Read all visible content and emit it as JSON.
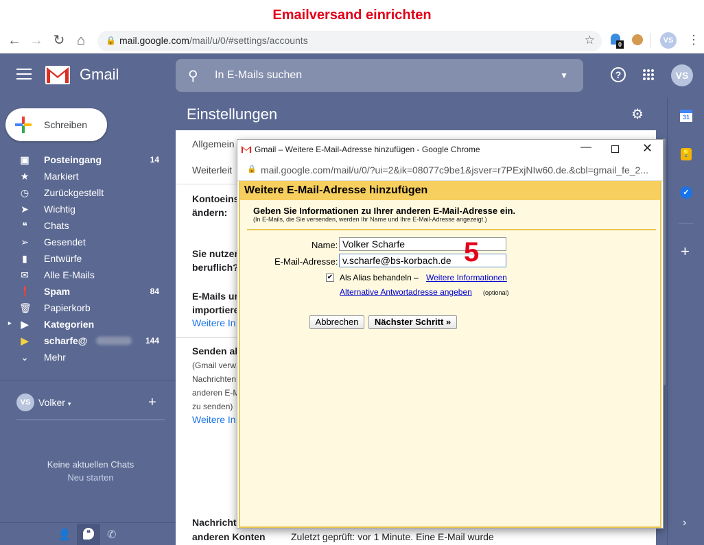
{
  "caption": "Emailversand einrichten",
  "browser": {
    "url_host": "mail.google.com",
    "url_path": "/mail/u/0/#settings/accounts",
    "ext_badge": "0",
    "profile": "VS"
  },
  "gmail": {
    "logo_text": "Gmail",
    "search_placeholder": "In E-Mails suchen",
    "avatar": "VS"
  },
  "compose_label": "Schreiben",
  "nav": [
    {
      "label": "Posteingang",
      "count": "14",
      "icon": "inbox-icon",
      "bold": true
    },
    {
      "label": "Markiert",
      "count": "",
      "icon": "star-icon",
      "bold": false
    },
    {
      "label": "Zurückgestellt",
      "count": "",
      "icon": "clock-icon",
      "bold": false
    },
    {
      "label": "Wichtig",
      "count": "",
      "icon": "important-icon",
      "bold": false
    },
    {
      "label": "Chats",
      "count": "",
      "icon": "chat-icon",
      "bold": false
    },
    {
      "label": "Gesendet",
      "count": "",
      "icon": "send-icon",
      "bold": false
    },
    {
      "label": "Entwürfe",
      "count": "",
      "icon": "draft-icon",
      "bold": false
    },
    {
      "label": "Alle E-Mails",
      "count": "",
      "icon": "mail-icon",
      "bold": false
    },
    {
      "label": "Spam",
      "count": "84",
      "icon": "spam-icon",
      "bold": true
    },
    {
      "label": "Papierkorb",
      "count": "",
      "icon": "trash-icon",
      "bold": false
    },
    {
      "label": "Kategorien",
      "count": "",
      "icon": "label-icon",
      "bold": true
    },
    {
      "label": "scharfe@",
      "count": "144",
      "icon": "label-yellow-icon",
      "bold": true
    },
    {
      "label": "Mehr",
      "count": "",
      "icon": "chevron-down-icon",
      "bold": false
    }
  ],
  "hangouts": {
    "user": "Volker",
    "avatar": "VS",
    "no_chats": "Keine aktuellen Chats",
    "start": "Neu starten"
  },
  "settings": {
    "title": "Einstellungen",
    "tab1": "Allgemein",
    "tab2": "Weiterleit",
    "s1a": "Kontoeins",
    "s1b": "ändern:",
    "s2a": "Sie nutzer",
    "s2b": "beruflich?",
    "s3a": "E-Mails ur",
    "s3b": "importiere",
    "s3link": "Weitere In",
    "s4a": "Senden als",
    "s4b": "(Gmail verw",
    "s4c": "Nachrichten",
    "s4d": "anderen E-M",
    "s4e": "zu senden)",
    "s4link": "Weitere In",
    "s5a": "Nachricht",
    "s5b": "anderen Konten",
    "s5val": "Zuletzt geprüft: vor 1 Minute. Eine E-Mail wurde"
  },
  "popup": {
    "window_title": "Gmail – Weitere E-Mail-Adresse hinzufügen - Google Chrome",
    "url": "mail.google.com/mail/u/0/?ui=2&ik=08077c9be1&jsver=r7PExjNIw60.de.&cbl=gmail_fe_2...",
    "heading": "Weitere E-Mail-Adresse hinzufügen",
    "intro": "Geben Sie Informationen zu Ihrer anderen E-Mail-Adresse ein.",
    "intro_small": "(In E-Mails, die Sie versenden, werden Ihr Name und Ihre E-Mail-Adresse angezeigt.)",
    "name_label": "Name:",
    "name_value": "Volker Scharfe",
    "email_label": "E-Mail-Adresse:",
    "email_value": "v.scharfe@bs-korbach.de",
    "step_marker": "5",
    "alias_label": "Als Alias behandeln –",
    "alias_link": "Weitere Informationen",
    "alias_checked": true,
    "reply_link": "Alternative Antwortadresse angeben",
    "optional": "(optional)",
    "cancel": "Abbrechen",
    "next": "Nächster Schritt »"
  },
  "colors": {
    "gmail_header": "#5b6992",
    "popup_header": "#f7cf5e",
    "popup_body": "#fff9e0",
    "caption_red": "#e2001a"
  }
}
